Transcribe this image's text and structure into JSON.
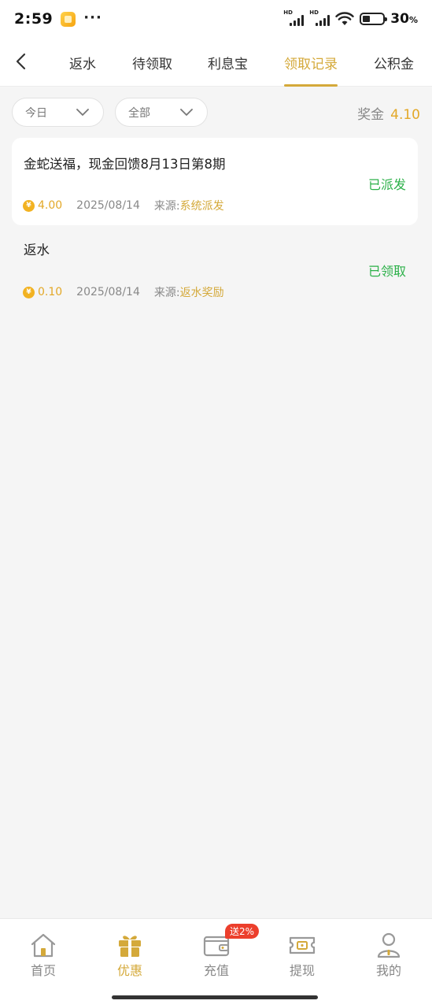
{
  "status_bar": {
    "time": "2:59",
    "more": "···",
    "signal_label": "HD",
    "battery_text": "30",
    "battery_unit": "%"
  },
  "nav": {
    "tabs": [
      {
        "label": "返水",
        "active": false
      },
      {
        "label": "待领取",
        "active": false
      },
      {
        "label": "利息宝",
        "active": false
      },
      {
        "label": "领取记录",
        "active": true
      },
      {
        "label": "公积金",
        "active": false
      }
    ]
  },
  "filters": {
    "date": "今日",
    "type": "全部",
    "bonus_label": "奖金",
    "bonus_value": "4.10"
  },
  "records": [
    {
      "title": "金蛇送福，现金回馈8月13日第8期",
      "status": "已派发",
      "amount": "4.00",
      "date": "2025/08/14",
      "source_label": "来源:",
      "source": "系统派发"
    },
    {
      "title": "返水",
      "status": "已领取",
      "amount": "0.10",
      "date": "2025/08/14",
      "source_label": "来源:",
      "source": "返水奖励"
    }
  ],
  "bottom_nav": {
    "items": [
      {
        "label": "首页",
        "icon": "home-icon",
        "active": false
      },
      {
        "label": "优惠",
        "icon": "gift-icon",
        "active": true
      },
      {
        "label": "充值",
        "icon": "wallet-icon",
        "active": false
      },
      {
        "label": "提现",
        "icon": "withdraw-ticket-icon",
        "active": false
      },
      {
        "label": "我的",
        "icon": "user-icon",
        "active": false
      }
    ],
    "promo_badge": "送2%"
  },
  "colors": {
    "accent": "#d4a93a",
    "gold": "#e3a827",
    "success": "#2bb048",
    "badge": "#ec3f2c"
  }
}
